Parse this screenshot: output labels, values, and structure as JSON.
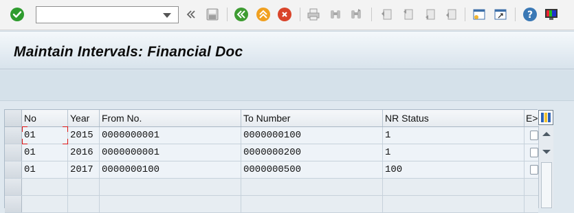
{
  "toolbar": {
    "command_placeholder": "",
    "command_value": "",
    "icons": [
      "enter-icon",
      "back-double-icon",
      "save-icon",
      "back-icon",
      "exit-icon",
      "cancel-icon",
      "print-icon",
      "find-icon",
      "find-next-icon",
      "first-page-icon",
      "previous-page-icon",
      "next-page-icon",
      "last-page-icon",
      "create-session-icon",
      "generate-shortcut-icon",
      "help-icon",
      "customize-layout-icon"
    ]
  },
  "title": "Maintain Intervals: Financial Doc",
  "table": {
    "columns": [
      "No",
      "Year",
      "From No.",
      "To Number",
      "NR Status",
      "E>"
    ],
    "rows": [
      {
        "no": "01",
        "year": "2015",
        "from": "0000000001",
        "to": "0000000100",
        "status": "1"
      },
      {
        "no": "01",
        "year": "2016",
        "from": "0000000001",
        "to": "0000000200",
        "status": "1"
      },
      {
        "no": "01",
        "year": "2017",
        "from": "0000000100",
        "to": "0000000500",
        "status": "100"
      }
    ]
  },
  "colors": {
    "title_band": "#d8e3ec",
    "grid_bg": "#eef2f6",
    "enter_green": "#2e9b2e",
    "exit_orange": "#f0a020",
    "cancel_red": "#d9442a",
    "help_blue": "#3a78b5"
  }
}
